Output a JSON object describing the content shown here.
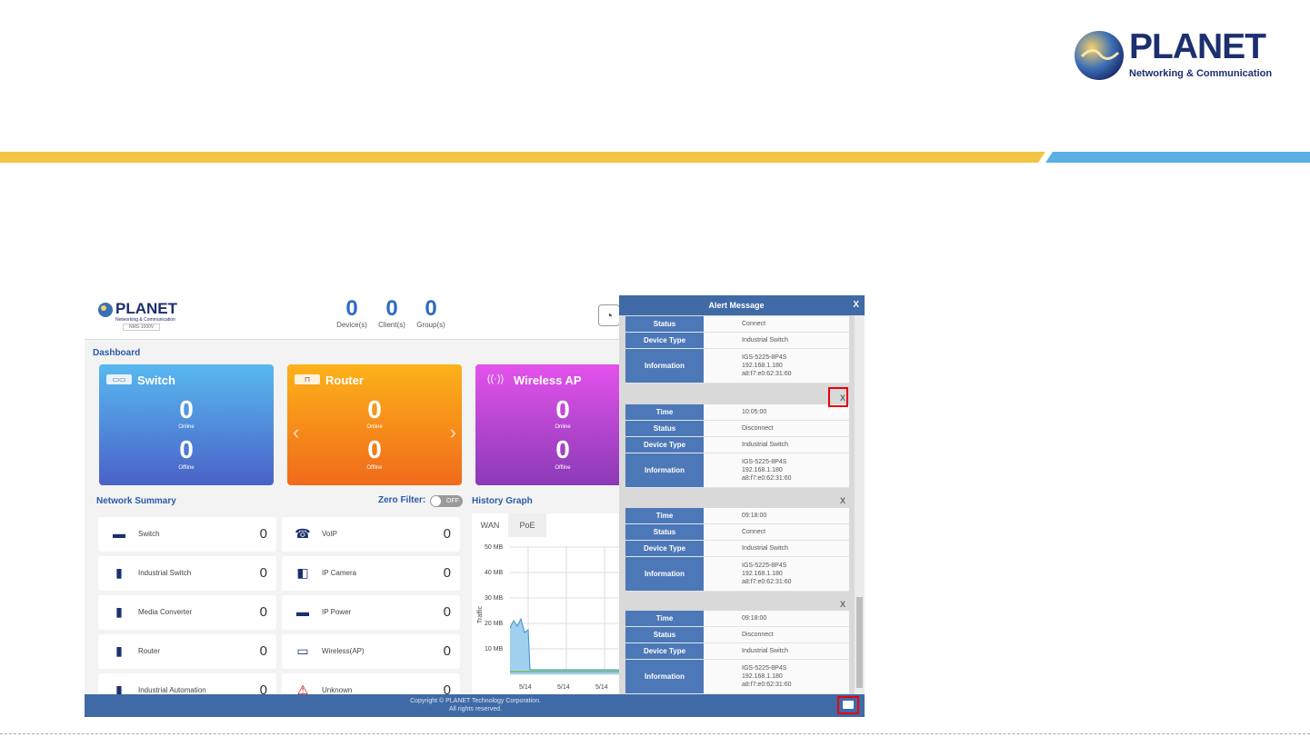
{
  "logo": {
    "brand": "PLANET",
    "tagline": "Networking & Communication"
  },
  "colors": {
    "band_yellow": "#f4c542",
    "band_blue": "#5ab0e3",
    "navy": "#1c2f6e",
    "panel_blue": "#3f6aa6",
    "highlight": "#e8000c"
  },
  "app": {
    "logo_brand": "PLANET",
    "logo_tag": "Networking & Communication",
    "logo_model": "NMS-1000V",
    "counters": [
      {
        "value": "0",
        "label": "Device(s)"
      },
      {
        "value": "0",
        "label": "Client(s)"
      },
      {
        "value": "0",
        "label": "Group(s)"
      }
    ],
    "gauge_icon": "speedometer-icon",
    "dashboard_title": "Dashboard",
    "cards": [
      {
        "title": "Switch",
        "online_value": "0",
        "online_label": "Online",
        "offline_value": "0",
        "offline_label": "Offline",
        "icon": "switch-icon"
      },
      {
        "title": "Router",
        "online_value": "0",
        "online_label": "Online",
        "offline_value": "0",
        "offline_label": "Offline",
        "icon": "router-icon"
      },
      {
        "title": "Wireless AP",
        "online_value": "0",
        "online_label": "Online",
        "offline_value": "0",
        "offline_label": "Offline",
        "icon": "wireless-icon"
      }
    ],
    "network_summary": {
      "title": "Network Summary",
      "zero_filter_label": "Zero Filter:",
      "toggle_state": "OFF",
      "left": [
        {
          "label": "Switch",
          "value": "0",
          "icon": "switch-icon"
        },
        {
          "label": "Industrial Switch",
          "value": "0",
          "icon": "industrial-switch-icon"
        },
        {
          "label": "Media Converter",
          "value": "0",
          "icon": "media-converter-icon"
        },
        {
          "label": "Router",
          "value": "0",
          "icon": "router-icon"
        },
        {
          "label": "Industrial Automation",
          "value": "0",
          "icon": "industrial-automation-icon"
        }
      ],
      "right": [
        {
          "label": "VoIP",
          "value": "0",
          "icon": "phone-icon"
        },
        {
          "label": "IP Camera",
          "value": "0",
          "icon": "camera-icon"
        },
        {
          "label": "IP Power",
          "value": "0",
          "icon": "power-strip-icon"
        },
        {
          "label": "Wireless(AP)",
          "value": "0",
          "icon": "access-point-icon"
        },
        {
          "label": "Unknown",
          "value": "0",
          "icon": "warning-icon"
        }
      ]
    },
    "history": {
      "title": "History Graph",
      "tabs": [
        "WAN",
        "PoE"
      ],
      "yticks": [
        "50 MB",
        "40 MB",
        "30 MB",
        "20 MB",
        "10 MB"
      ],
      "ylabel": "Traffic",
      "xticks": [
        "5/14",
        "5/14",
        "5/14"
      ]
    },
    "footer": {
      "line1": "Copyright © PLANET Technology Corporation.",
      "line2": "All rights reserved."
    }
  },
  "alert": {
    "title": "Alert Message",
    "close": "X",
    "groups": [
      {
        "rows": [
          {
            "k": "Status",
            "v": "Connect"
          },
          {
            "k": "Device Type",
            "v": "Industrial Switch"
          },
          {
            "k": "Information",
            "v": "IGS-5225-8P4S\n192.168.1.180\na8:f7:e0:62:31:60"
          }
        ]
      },
      {
        "close": "X",
        "rows": [
          {
            "k": "Time",
            "v": "10:05:00"
          },
          {
            "k": "Status",
            "v": "Disconnect"
          },
          {
            "k": "Device Type",
            "v": "Industrial Switch"
          },
          {
            "k": "Information",
            "v": "IGS-5225-8P4S\n192.168.1.180\na8:f7:e0:62:31:60"
          }
        ]
      },
      {
        "close": "X",
        "rows": [
          {
            "k": "Time",
            "v": "09:18:00"
          },
          {
            "k": "Status",
            "v": "Connect"
          },
          {
            "k": "Device Type",
            "v": "Industrial Switch"
          },
          {
            "k": "Information",
            "v": "IGS-5225-8P4S\n192.168.1.180\na8:f7:e0:62:31:60"
          }
        ]
      },
      {
        "close": "X",
        "rows": [
          {
            "k": "Time",
            "v": "09:18:00"
          },
          {
            "k": "Status",
            "v": "Disconnect"
          },
          {
            "k": "Device Type",
            "v": "Industrial Switch"
          },
          {
            "k": "Information",
            "v": "IGS-5225-8P4S\n192.168.1.180\na8:f7:e0:62:31:60"
          }
        ]
      }
    ]
  }
}
